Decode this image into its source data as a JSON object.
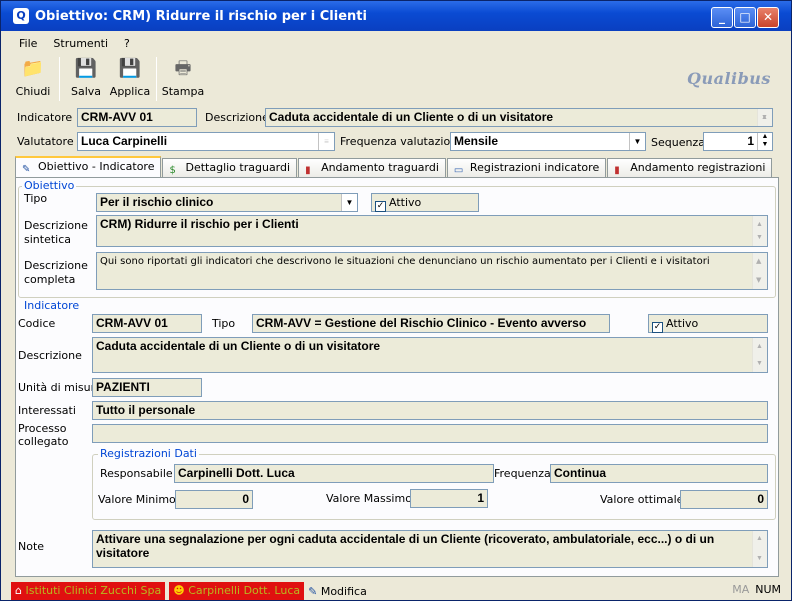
{
  "window": {
    "title": "Obiettivo: CRM) Ridurre il rischio per i Clienti",
    "min": "_",
    "max": "□",
    "close": "✕"
  },
  "menu": [
    "File",
    "Strumenti",
    "?"
  ],
  "toolbar": {
    "close": "Chiudi",
    "save": "Salva",
    "apply": "Applica",
    "print": "Stampa"
  },
  "logo": "Qualibus",
  "header": {
    "indicator_label": "Indicatore",
    "indicator_value": "CRM-AVV 01",
    "description_label": "Descrizione",
    "description_value": "Caduta accidentale di un Cliente o di un visitatore",
    "evaluator_label": "Valutatore",
    "evaluator_value": "Luca Carpinelli",
    "frequency_label": "Frequenza valutazione",
    "frequency_value": "Mensile",
    "sequence_label": "Sequenza",
    "sequence_value": "1"
  },
  "tabs": [
    "Obiettivo - Indicatore",
    "Dettaglio traguardi",
    "Andamento traguardi",
    "Registrazioni indicatore",
    "Andamento registrazioni"
  ],
  "objective": {
    "group": "Obiettivo",
    "type_label": "Tipo",
    "type_value": "Per il rischio clinico",
    "active_label": "Attivo",
    "short_label": "Descrizione sintetica",
    "short_value": "CRM) Ridurre il rischio per i Clienti",
    "full_label": "Descrizione completa",
    "full_value": "Qui sono riportati gli indicatori che descrivono le situazioni che denunciano un rischio aumentato per i Clienti e i visitatori"
  },
  "indicator": {
    "group": "Indicatore",
    "code_label": "Codice",
    "code_value": "CRM-AVV 01",
    "type_label": "Tipo",
    "type_value": "CRM-AVV = Gestione del Rischio Clinico - Evento avverso",
    "active_label": "Attivo",
    "desc_label": "Descrizione",
    "desc_value": "Caduta accidentale di un Cliente o di un visitatore",
    "unit_label": "Unità di misura",
    "unit_value": "PAZIENTI",
    "interested_label": "Interessati",
    "interested_value": "Tutto il personale",
    "process_label": "Processo collegato",
    "process_value": ""
  },
  "registrations": {
    "group": "Registrazioni Dati",
    "resp_label": "Responsabile",
    "resp_value": "Carpinelli Dott. Luca",
    "freq_label": "Frequenza",
    "freq_value": "Continua",
    "min_label": "Valore Minimo",
    "min_value": "0",
    "max_label": "Valore Massimo",
    "max_value": "1",
    "opt_label": "Valore ottimale",
    "opt_value": "0"
  },
  "notes": {
    "label": "Note",
    "value": "Attivare una segnalazione per ogni caduta accidentale di un Cliente (ricoverato, ambulatoriale, ecc...) o di un visitatore"
  },
  "status": {
    "company": "Istituti Clinici Zucchi Spa",
    "user": "Carpinelli Dott. Luca",
    "mode": "Modifica",
    "ma": "MA",
    "num": "NUM"
  }
}
